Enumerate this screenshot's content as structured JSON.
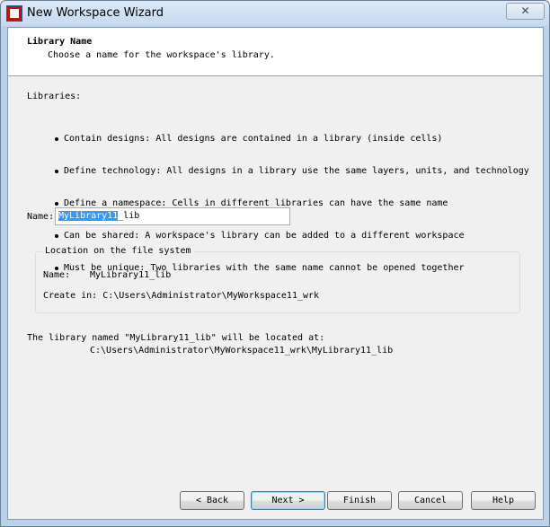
{
  "window": {
    "title": "New Workspace Wizard",
    "close_glyph": "✕"
  },
  "header": {
    "title": "Library Name",
    "subtitle": "Choose a name for the workspace's library."
  },
  "body": {
    "libraries_label": "Libraries:",
    "bullets": [
      "Contain designs: All designs are contained in a library (inside cells)",
      "Define technology: All designs in a library use the same layers, units, and technology",
      "Define a namespace: Cells in different libraries can have the same name",
      "Can be shared: A workspace's library can be added to a different workspace",
      "Must be unique: Two libraries with the same name cannot be opened together"
    ],
    "name_label": "Name:",
    "name_value_selected": "MyLibrary11",
    "name_value_rest": "_lib"
  },
  "location": {
    "legend": "Location on the file system",
    "name_label": "Name:",
    "name_value": "MyLibrary11_lib",
    "create_in": "Create in: C:\\Users\\Administrator\\MyWorkspace11_wrk"
  },
  "message": {
    "line1": "The library named \"MyLibrary11_lib\" will be located at:",
    "line2": "C:\\Users\\Administrator\\MyWorkspace11_wrk\\MyLibrary11_lib"
  },
  "buttons": {
    "back": "< Back",
    "next": "Next >",
    "finish": "Finish",
    "cancel": "Cancel",
    "help": "Help"
  },
  "icons": {
    "app": "app-logo-icon",
    "close": "close-icon"
  }
}
